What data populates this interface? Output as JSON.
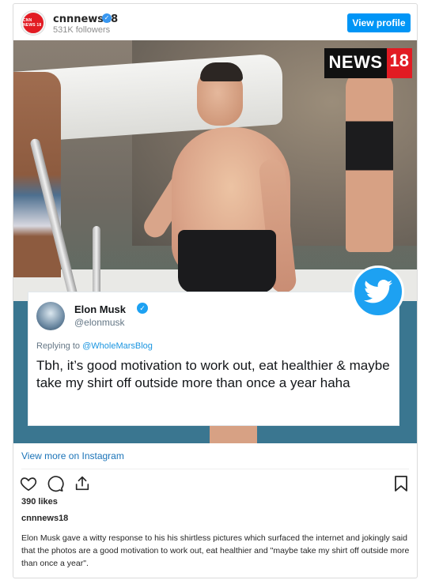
{
  "header": {
    "avatar_text": "CNN NEWS 18",
    "username": "cnnnews18",
    "followers": "531K followers",
    "view_profile_label": "View profile"
  },
  "photo": {
    "news_logo_text": "NEWS",
    "news_logo_number": "18",
    "brand_color": "#e21b23"
  },
  "tweet": {
    "name": "Elon Musk",
    "handle": "@elonmusk",
    "replying_prefix": "Replying to ",
    "replying_to": "@WholeMarsBlog",
    "text": "Tbh, it’s good motivation to work out, eat healthier & maybe take my shirt off outside more than once a year haha",
    "accent_color": "#1da1f2"
  },
  "footer": {
    "view_more_label": "View more on Instagram",
    "likes": "390 likes",
    "caption_user": "cnnnews18",
    "caption": "Elon Musk gave a witty response to his his shirtless pictures which surfaced the internet and jokingly said that the photos are a good motivation to work out, eat healthier and \"maybe take my shirt off outside more than once a year\"."
  },
  "icons": [
    "heart-icon",
    "comment-icon",
    "share-icon",
    "bookmark-icon",
    "twitter-bird-icon",
    "verified-icon"
  ]
}
